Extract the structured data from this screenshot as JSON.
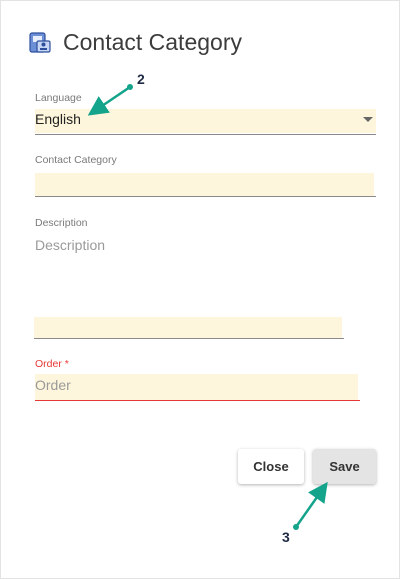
{
  "dialog": {
    "title": "Contact Category",
    "title_icon": "contact-card-icon"
  },
  "form": {
    "language": {
      "label": "Language",
      "value": "English"
    },
    "contact_category": {
      "label": "Contact Category",
      "value": ""
    },
    "description": {
      "label": "Description",
      "placeholder": "Description"
    },
    "order": {
      "label": "Order *",
      "placeholder": "Order"
    }
  },
  "buttons": {
    "close_label": "Close",
    "save_label": "Save"
  },
  "annotations": {
    "marker_2": "2",
    "marker_3": "3",
    "arrow_color": "#14a38b"
  },
  "colors": {
    "field_background": "#fdf6dc",
    "required": "#e53935"
  }
}
